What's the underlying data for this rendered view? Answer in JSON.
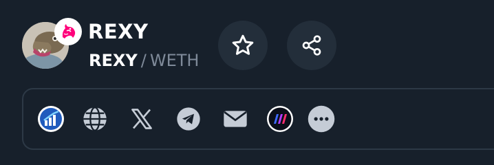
{
  "token": {
    "name": "REXY",
    "base_symbol": "REXY",
    "separator": "/",
    "quote_symbol": "WETH"
  },
  "icons": {
    "avatar": "rexy-dinosaur-avatar",
    "dex_badge": "uniswap-unicorn-icon",
    "watchlist": "star-outline-icon",
    "share": "share-icon"
  },
  "links": [
    {
      "icon": "coin-chart-icon"
    },
    {
      "icon": "globe-icon"
    },
    {
      "icon": "x-twitter-icon"
    },
    {
      "icon": "telegram-icon"
    },
    {
      "icon": "email-icon"
    },
    {
      "icon": "dextools-icon"
    },
    {
      "icon": "more-dots-icon"
    }
  ],
  "colors": {
    "background": "#17202b",
    "button_background": "#232e3a",
    "panel_border": "#2d3946",
    "icon": "#c5ccd6",
    "uniswap_pink": "#ff007a",
    "muted_text": "#7f8a99"
  }
}
